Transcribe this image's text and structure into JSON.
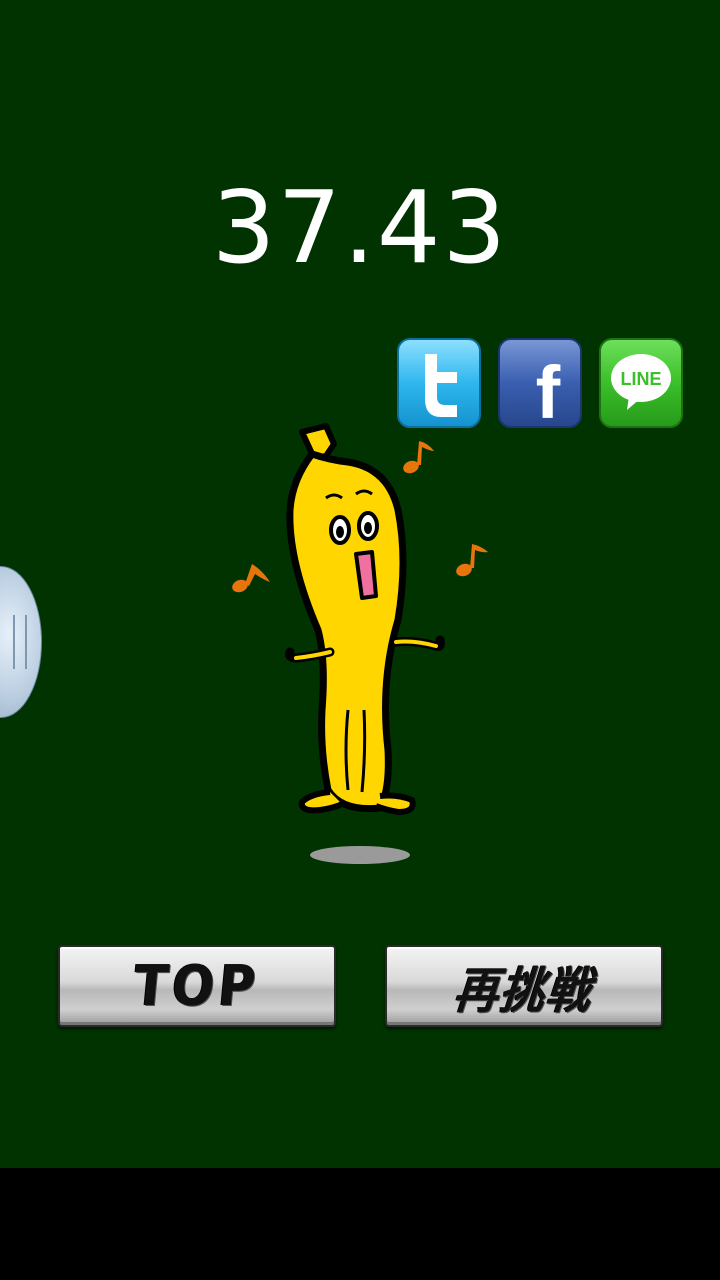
{
  "game": {
    "score": "37.43"
  },
  "share": {
    "twitter_icon": "twitter-icon",
    "facebook_icon": "facebook-icon",
    "line_icon": "line-icon",
    "line_label": "LINE",
    "facebook_letter": "f"
  },
  "buttons": {
    "top_label": "TOP",
    "retry_label": "再挑戦"
  },
  "character": {
    "name_icon": "dancing-banana-icon",
    "note_icon": "music-note-icon"
  },
  "colors": {
    "background": "#003300",
    "banana": "#ffd600",
    "note": "#e8740c",
    "twitter": "#2fb7ee",
    "facebook": "#3a5fb0",
    "line": "#3bbf2a"
  }
}
